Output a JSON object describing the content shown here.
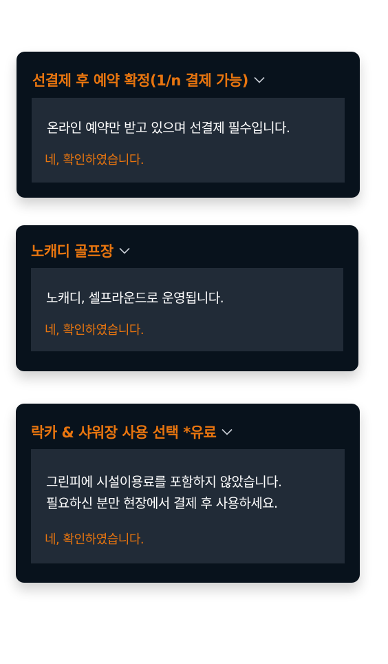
{
  "cards": [
    {
      "title": "선결제 후 예약 확정(1/n 결제 가능)",
      "lines": [
        "온라인 예약만 받고 있으며 선결제 필수입니다."
      ],
      "confirm": "네, 확인하였습니다."
    },
    {
      "title": "노캐디 골프장",
      "lines": [
        "노캐디, 셀프라운드로 운영됩니다."
      ],
      "confirm": "네, 확인하였습니다."
    },
    {
      "title": "락카 & 샤워장 사용 선택 *유료",
      "lines": [
        "그린피에 시설이용료를 포함하지 않았습니다.",
        "필요하신 분만 현장에서 결제 후 사용하세요."
      ],
      "confirm": "네, 확인하였습니다."
    }
  ],
  "colors": {
    "card_bg": "#08121c",
    "panel_bg": "#212b37",
    "accent": "#e8750f",
    "text": "#ffffff"
  },
  "icons": {
    "toggle": "chevron-down-icon"
  }
}
